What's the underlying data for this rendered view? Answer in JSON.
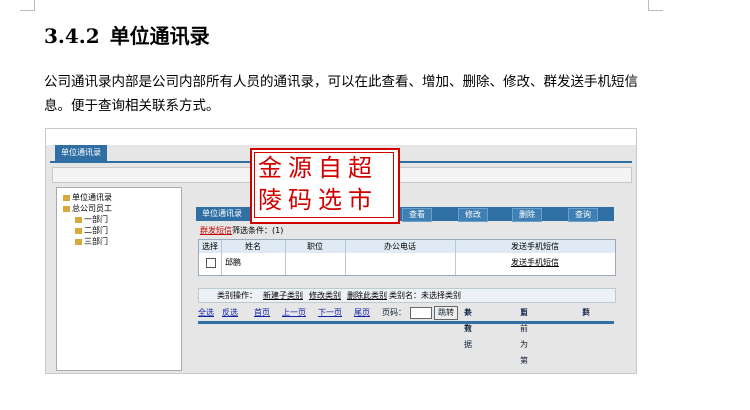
{
  "heading": {
    "number": "3.4.2",
    "title": "单位通讯录"
  },
  "paragraph": "公司通讯录内部是公司内部所有人员的通讯录，可以在此查看、增加、删除、修改、群发送手机短信息。便于查询相关联系方式。",
  "screenshot": {
    "tab": "单位通讯录",
    "tree": {
      "root": "单位通讯录",
      "company": "总公司员工",
      "departments": [
        "一部门",
        "二部门",
        "三部门"
      ]
    },
    "toolbar": {
      "title": "单位通讯录",
      "buttons": [
        "查看",
        "修改",
        "删除",
        "查询"
      ]
    },
    "link_row": {
      "red_link": "群发短信",
      "rest": "筛选条件：(1)"
    },
    "table": {
      "headers": [
        "选择",
        "姓名",
        "职位",
        "办公电话",
        "发送手机短信"
      ],
      "row": {
        "name": "邱鹏",
        "send": "发送手机短信"
      }
    },
    "category_ops": {
      "label": "类别操作：",
      "links": [
        "新建子类别",
        "修改类别",
        "删除此类别"
      ],
      "category_name": "类别名：未选择类别"
    },
    "pager": {
      "select_all": "全选",
      "invert": "反选",
      "first": "首页",
      "prev": "上一页",
      "next": "下一页",
      "last": "尾页",
      "page_label": "页码：",
      "jump": "跳转",
      "total_prefix": "共有",
      "total_count": "1",
      "total_suffix": "条数据",
      "current_prefix": "当前为第",
      "current_page": "1",
      "current_suffix": "页",
      "pages_prefix": "共",
      "pages_count": "1",
      "pages_suffix": "页"
    }
  },
  "stamp": {
    "line1": "金源自超",
    "line2": "陵码选市",
    "color": "#d30000"
  }
}
